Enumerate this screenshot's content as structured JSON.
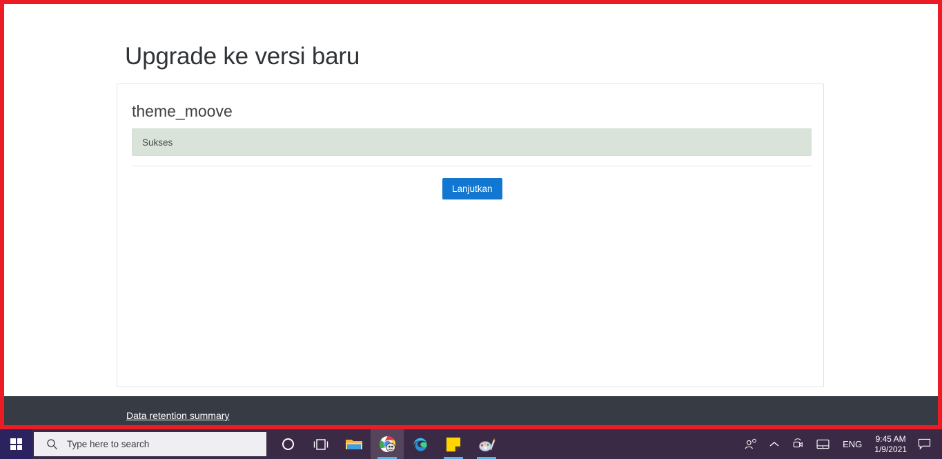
{
  "page": {
    "title": "Upgrade ke versi baru",
    "card": {
      "plugin_name": "theme_moove",
      "alert": {
        "text": "Sukses",
        "type": "success",
        "bg_color": "#d9e3d9"
      },
      "continue_button": "Lanjutkan",
      "button_color": "#1177d1"
    },
    "footer": {
      "link_label": "Data retention summary",
      "bg_color": "#373b44"
    },
    "capture_border_color": "#ed1c24"
  },
  "taskbar": {
    "bg_color": "#3b2a46",
    "start_icon": "windows-logo-icon",
    "search": {
      "placeholder": "Type here to search",
      "icon": "search-icon"
    },
    "items": [
      {
        "name": "cortana-icon",
        "label": "Cortana",
        "state": "idle"
      },
      {
        "name": "task-view-icon",
        "label": "Task View",
        "state": "idle"
      },
      {
        "name": "file-explorer-icon",
        "label": "File Explorer",
        "state": "idle"
      },
      {
        "name": "google-chrome-icon",
        "label": "Google Chrome",
        "state": "active"
      },
      {
        "name": "microsoft-edge-icon",
        "label": "Microsoft Edge",
        "state": "idle"
      },
      {
        "name": "sticky-notes-icon",
        "label": "Sticky Notes",
        "state": "running"
      },
      {
        "name": "paint-icon",
        "label": "Paint 3D",
        "state": "running"
      }
    ],
    "tray": {
      "people_icon": "people-icon",
      "chevron_icon": "chevron-up-icon",
      "meet_now_icon": "meet-now-camera-icon",
      "touchpad_icon": "touchpad-icon",
      "language": "ENG",
      "time": "9:45 AM",
      "date": "1/9/2021",
      "notification_icon": "notification-chat-icon"
    }
  }
}
